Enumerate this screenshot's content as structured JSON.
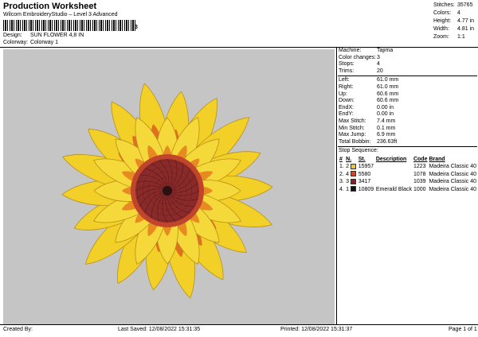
{
  "header": {
    "title": "Production Worksheet",
    "subtitle": "Wilcom EmbroideryStudio – Level 3 Advanced",
    "barcode_digit": "3",
    "design_label": "Design:",
    "design_value": "SUN FLOWER 4,8 IN",
    "colorway_label": "Colorway:",
    "colorway_value": "Colorway 1"
  },
  "stats": [
    {
      "label": "Stitches:",
      "value": "35765"
    },
    {
      "label": "Colors:",
      "value": "4"
    },
    {
      "label": "Height:",
      "value": "4.77 in"
    },
    {
      "label": "Width:",
      "value": "4.81 in"
    },
    {
      "label": "Zoom:",
      "value": "1:1"
    }
  ],
  "machine_info": [
    {
      "label": "Machine:",
      "value": "Tajima"
    },
    {
      "label": "Color changes:",
      "value": "3"
    },
    {
      "label": "Stops:",
      "value": "4"
    },
    {
      "label": "Trims:",
      "value": "20"
    }
  ],
  "extent_info": [
    {
      "label": "Left:",
      "value": "61.0 mm"
    },
    {
      "label": "Right:",
      "value": "61.0 mm"
    },
    {
      "label": "Up:",
      "value": "60.6 mm"
    },
    {
      "label": "Down:",
      "value": "60.6 mm"
    },
    {
      "label": "EndX:",
      "value": "0.00 in"
    },
    {
      "label": "EndY:",
      "value": "0.00 in"
    },
    {
      "label": "Max Stitch:",
      "value": "7.4 mm"
    },
    {
      "label": "Min Stitch:",
      "value": "0.1 mm"
    },
    {
      "label": "Max Jump:",
      "value": "6.9 mm"
    },
    {
      "label": "Total Bobbin:",
      "value": "236.63ft"
    }
  ],
  "stop_sequence": {
    "title": "Stop Sequence:",
    "columns": [
      "#",
      "N.",
      "St.",
      "Description",
      "Code",
      "Brand"
    ],
    "rows": [
      {
        "num": "1.",
        "n": "2",
        "color": "#f2c321",
        "st": "15957",
        "desc": "",
        "code": "1223",
        "brand": "Madeira Classic 40"
      },
      {
        "num": "2.",
        "n": "4",
        "color": "#d9461c",
        "st": "5580",
        "desc": "",
        "code": "1078",
        "brand": "Madeira Classic 40"
      },
      {
        "num": "3.",
        "n": "3",
        "color": "#8a1f22",
        "st": "3417",
        "desc": "",
        "code": "1039",
        "brand": "Madeira Classic 40"
      },
      {
        "num": "4.",
        "n": "1",
        "color": "#111111",
        "st": "10809",
        "desc": "Emerald Black",
        "code": "1000",
        "brand": "Madeira Classic 40"
      }
    ]
  },
  "footer": {
    "created_by": "Created By:",
    "last_saved": "Last Saved: 12/08/2022 15:31:35",
    "printed": "Printed: 12/08/2022 15:31:37",
    "page": "Page 1 of 1"
  },
  "colors": {
    "canvas_bg": "#c5c5c5",
    "petal_yellow": "#f2d028",
    "petal_orange": "#e0701f",
    "center_red": "#8a2a2a"
  }
}
